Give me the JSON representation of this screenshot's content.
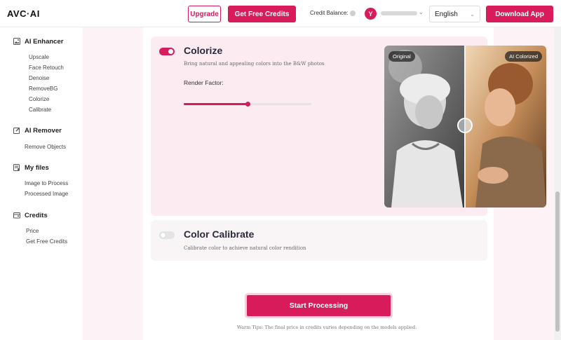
{
  "header": {
    "logo": "AVC·AI",
    "upgrade": "Upgrade",
    "get_free_credits": "Get Free Credits",
    "credit_balance": "Credit Balance:",
    "avatar_initial": "Y",
    "language": "English",
    "download_app": "Download App"
  },
  "sidebar": {
    "sections": [
      {
        "title": "AI Enhancer",
        "icon": "image-icon",
        "items": [
          "Upscale",
          "Face Retouch",
          "Denoise",
          "RemoveBG",
          "Colorize",
          "Calibrate"
        ]
      },
      {
        "title": "AI Remover",
        "icon": "edit-icon",
        "items": [
          "Remove Objects"
        ]
      },
      {
        "title": "My files",
        "icon": "files-icon",
        "items": [
          "Image to Process",
          "Processed Image"
        ]
      },
      {
        "title": "Credits",
        "icon": "wallet-icon",
        "items": [
          "Price",
          "Get Free Credits"
        ]
      }
    ]
  },
  "colorize": {
    "title": "Colorize",
    "description": "Bring natural and appealing colors into the B&W photos",
    "render_factor_label": "Render Factor:",
    "render_factor_fraction": 0.5,
    "enabled": true,
    "badge_original": "Original",
    "badge_colorized": "AI Colorized"
  },
  "calibrate": {
    "title": "Color Calibrate",
    "description": "Calibrate color to achieve natural color rendition",
    "enabled": false
  },
  "actions": {
    "start": "Start Processing",
    "tips": "Warm Tips: The final price in credits varies depending on the models applied."
  },
  "colors": {
    "accent": "#d81b5a",
    "background": "#fdf2f5",
    "card": "#fcecf1"
  }
}
